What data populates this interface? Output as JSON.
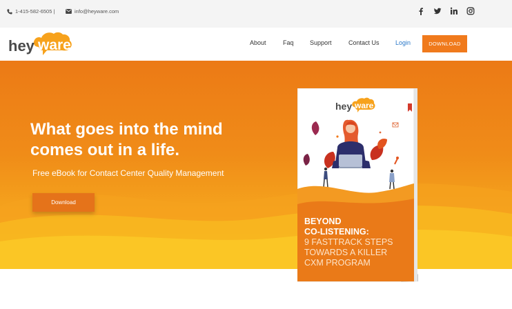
{
  "topbar": {
    "phone": "1-415-582-6505 |",
    "email": "info@heyware.com",
    "social": [
      "facebook-icon",
      "twitter-icon",
      "linkedin-icon",
      "instagram-icon"
    ]
  },
  "nav": {
    "logo_text": "heyware",
    "items": [
      {
        "label": "About"
      },
      {
        "label": "Faq"
      },
      {
        "label": "Support"
      },
      {
        "label": "Contact Us"
      },
      {
        "label": "Login"
      }
    ],
    "download_label": "DOWNLOAD"
  },
  "hero": {
    "headline_line1": "What goes into the mind",
    "headline_line2": "comes out in a life.",
    "subline": "Free eBook for Contact Center Quality Management",
    "download_label": "Download"
  },
  "book": {
    "logo_text": "heyware",
    "line1": "BEYOND",
    "line2": "CO-LISTENING:",
    "line3": "9 FASTTRACK STEPS",
    "line4": "TOWARDS A KILLER",
    "line5": "CXM PROGRAM"
  },
  "colors": {
    "brand_orange": "#f07a1c",
    "login_blue": "#2a78c8",
    "hero_top": "#ec7a16",
    "hero_bottom": "#f8bf22"
  }
}
